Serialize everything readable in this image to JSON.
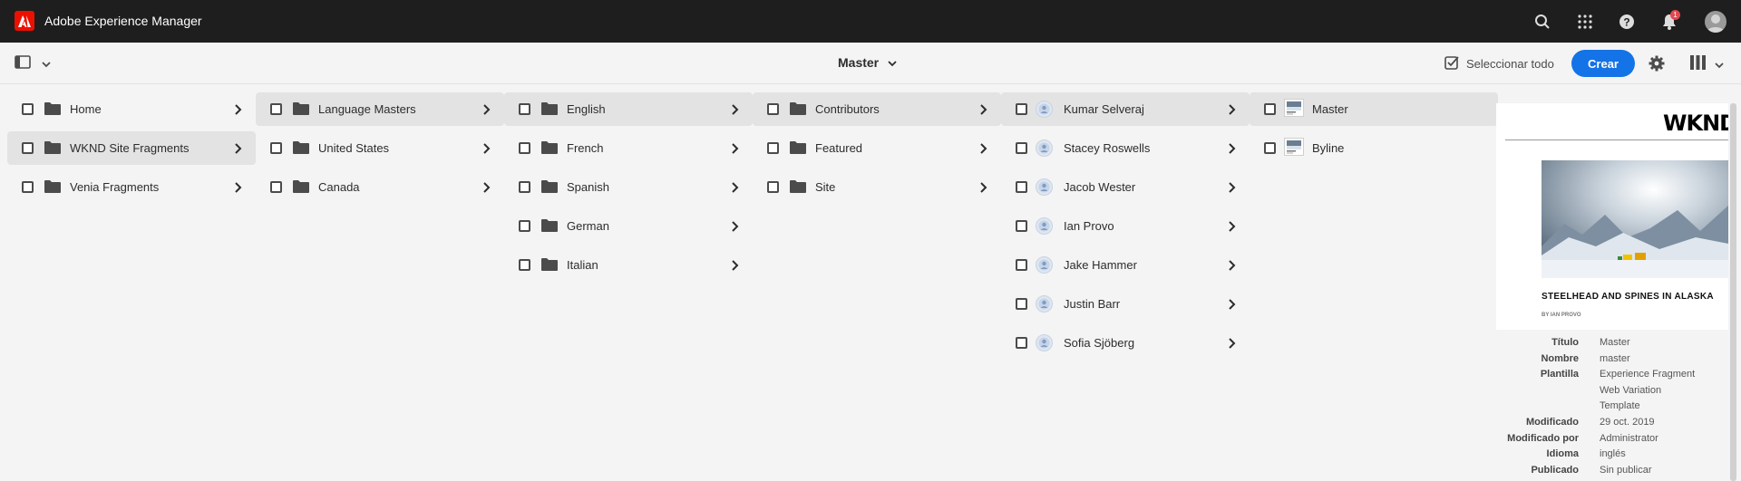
{
  "shell": {
    "app_title": "Adobe Experience Manager",
    "notification_count": "1"
  },
  "actionbar": {
    "breadcrumb": "Master",
    "select_all": "Seleccionar todo",
    "create": "Crear"
  },
  "columns": [
    {
      "items": [
        {
          "label": "Home",
          "type": "folder",
          "selected": false
        },
        {
          "label": "WKND Site Fragments",
          "type": "folder",
          "selected": true
        },
        {
          "label": "Venia Fragments",
          "type": "folder",
          "selected": false
        }
      ]
    },
    {
      "items": [
        {
          "label": "Language Masters",
          "type": "folder",
          "selected": true
        },
        {
          "label": "United States",
          "type": "folder",
          "selected": false
        },
        {
          "label": "Canada",
          "type": "folder",
          "selected": false
        }
      ]
    },
    {
      "items": [
        {
          "label": "English",
          "type": "folder",
          "selected": true
        },
        {
          "label": "French",
          "type": "folder",
          "selected": false
        },
        {
          "label": "Spanish",
          "type": "folder",
          "selected": false
        },
        {
          "label": "German",
          "type": "folder",
          "selected": false
        },
        {
          "label": "Italian",
          "type": "folder",
          "selected": false
        }
      ]
    },
    {
      "items": [
        {
          "label": "Contributors",
          "type": "folder",
          "selected": true
        },
        {
          "label": "Featured",
          "type": "folder",
          "selected": false
        },
        {
          "label": "Site",
          "type": "folder",
          "selected": false
        }
      ]
    },
    {
      "items": [
        {
          "label": "Kumar Selveraj",
          "type": "fragment",
          "selected": true
        },
        {
          "label": "Stacey Roswells",
          "type": "fragment",
          "selected": false
        },
        {
          "label": "Jacob Wester",
          "type": "fragment",
          "selected": false
        },
        {
          "label": "Ian Provo",
          "type": "fragment",
          "selected": false
        },
        {
          "label": "Jake Hammer",
          "type": "fragment",
          "selected": false
        },
        {
          "label": "Justin Barr",
          "type": "fragment",
          "selected": false
        },
        {
          "label": "Sofia Sjöberg",
          "type": "fragment",
          "selected": false
        }
      ]
    },
    {
      "items": [
        {
          "label": "Master",
          "type": "variation",
          "selected": true
        },
        {
          "label": "Byline",
          "type": "variation",
          "selected": false
        }
      ]
    }
  ],
  "preview": {
    "title": "WKND S",
    "headline": "STEELHEAD AND SPINES IN ALASKA",
    "byline": "BY IAN PROVO"
  },
  "properties": [
    {
      "key": "Título",
      "value": "Master"
    },
    {
      "key": "Nombre",
      "value": "master"
    },
    {
      "key": "Plantilla",
      "value": "Experience Fragment"
    },
    {
      "key": "",
      "value": "Web Variation"
    },
    {
      "key": "",
      "value": "Template"
    },
    {
      "key": "Modificado",
      "value": "29 oct. 2019"
    },
    {
      "key": "Modificado por",
      "value": "Administrator"
    },
    {
      "key": "Idioma",
      "value": "inglés"
    },
    {
      "key": "Publicado",
      "value": "Sin publicar"
    }
  ]
}
